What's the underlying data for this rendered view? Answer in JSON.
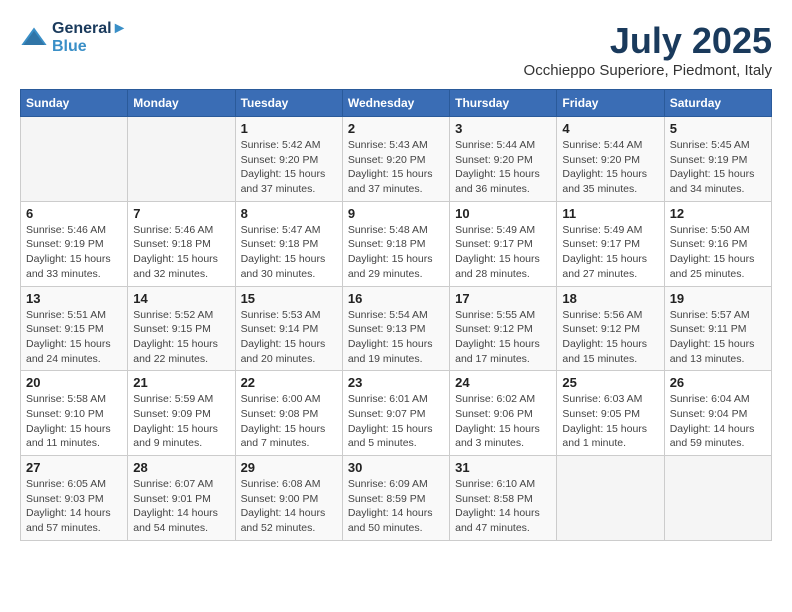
{
  "header": {
    "logo_line1": "General",
    "logo_line2": "Blue",
    "title": "July 2025",
    "subtitle": "Occhieppo Superiore, Piedmont, Italy"
  },
  "days_of_week": [
    "Sunday",
    "Monday",
    "Tuesday",
    "Wednesday",
    "Thursday",
    "Friday",
    "Saturday"
  ],
  "weeks": [
    [
      {
        "num": "",
        "empty": true
      },
      {
        "num": "",
        "empty": true
      },
      {
        "num": "1",
        "sunrise": "5:42 AM",
        "sunset": "9:20 PM",
        "daylight": "15 hours and 37 minutes."
      },
      {
        "num": "2",
        "sunrise": "5:43 AM",
        "sunset": "9:20 PM",
        "daylight": "15 hours and 37 minutes."
      },
      {
        "num": "3",
        "sunrise": "5:44 AM",
        "sunset": "9:20 PM",
        "daylight": "15 hours and 36 minutes."
      },
      {
        "num": "4",
        "sunrise": "5:44 AM",
        "sunset": "9:20 PM",
        "daylight": "15 hours and 35 minutes."
      },
      {
        "num": "5",
        "sunrise": "5:45 AM",
        "sunset": "9:19 PM",
        "daylight": "15 hours and 34 minutes."
      }
    ],
    [
      {
        "num": "6",
        "sunrise": "5:46 AM",
        "sunset": "9:19 PM",
        "daylight": "15 hours and 33 minutes."
      },
      {
        "num": "7",
        "sunrise": "5:46 AM",
        "sunset": "9:18 PM",
        "daylight": "15 hours and 32 minutes."
      },
      {
        "num": "8",
        "sunrise": "5:47 AM",
        "sunset": "9:18 PM",
        "daylight": "15 hours and 30 minutes."
      },
      {
        "num": "9",
        "sunrise": "5:48 AM",
        "sunset": "9:18 PM",
        "daylight": "15 hours and 29 minutes."
      },
      {
        "num": "10",
        "sunrise": "5:49 AM",
        "sunset": "9:17 PM",
        "daylight": "15 hours and 28 minutes."
      },
      {
        "num": "11",
        "sunrise": "5:49 AM",
        "sunset": "9:17 PM",
        "daylight": "15 hours and 27 minutes."
      },
      {
        "num": "12",
        "sunrise": "5:50 AM",
        "sunset": "9:16 PM",
        "daylight": "15 hours and 25 minutes."
      }
    ],
    [
      {
        "num": "13",
        "sunrise": "5:51 AM",
        "sunset": "9:15 PM",
        "daylight": "15 hours and 24 minutes."
      },
      {
        "num": "14",
        "sunrise": "5:52 AM",
        "sunset": "9:15 PM",
        "daylight": "15 hours and 22 minutes."
      },
      {
        "num": "15",
        "sunrise": "5:53 AM",
        "sunset": "9:14 PM",
        "daylight": "15 hours and 20 minutes."
      },
      {
        "num": "16",
        "sunrise": "5:54 AM",
        "sunset": "9:13 PM",
        "daylight": "15 hours and 19 minutes."
      },
      {
        "num": "17",
        "sunrise": "5:55 AM",
        "sunset": "9:12 PM",
        "daylight": "15 hours and 17 minutes."
      },
      {
        "num": "18",
        "sunrise": "5:56 AM",
        "sunset": "9:12 PM",
        "daylight": "15 hours and 15 minutes."
      },
      {
        "num": "19",
        "sunrise": "5:57 AM",
        "sunset": "9:11 PM",
        "daylight": "15 hours and 13 minutes."
      }
    ],
    [
      {
        "num": "20",
        "sunrise": "5:58 AM",
        "sunset": "9:10 PM",
        "daylight": "15 hours and 11 minutes."
      },
      {
        "num": "21",
        "sunrise": "5:59 AM",
        "sunset": "9:09 PM",
        "daylight": "15 hours and 9 minutes."
      },
      {
        "num": "22",
        "sunrise": "6:00 AM",
        "sunset": "9:08 PM",
        "daylight": "15 hours and 7 minutes."
      },
      {
        "num": "23",
        "sunrise": "6:01 AM",
        "sunset": "9:07 PM",
        "daylight": "15 hours and 5 minutes."
      },
      {
        "num": "24",
        "sunrise": "6:02 AM",
        "sunset": "9:06 PM",
        "daylight": "15 hours and 3 minutes."
      },
      {
        "num": "25",
        "sunrise": "6:03 AM",
        "sunset": "9:05 PM",
        "daylight": "15 hours and 1 minute."
      },
      {
        "num": "26",
        "sunrise": "6:04 AM",
        "sunset": "9:04 PM",
        "daylight": "14 hours and 59 minutes."
      }
    ],
    [
      {
        "num": "27",
        "sunrise": "6:05 AM",
        "sunset": "9:03 PM",
        "daylight": "14 hours and 57 minutes."
      },
      {
        "num": "28",
        "sunrise": "6:07 AM",
        "sunset": "9:01 PM",
        "daylight": "14 hours and 54 minutes."
      },
      {
        "num": "29",
        "sunrise": "6:08 AM",
        "sunset": "9:00 PM",
        "daylight": "14 hours and 52 minutes."
      },
      {
        "num": "30",
        "sunrise": "6:09 AM",
        "sunset": "8:59 PM",
        "daylight": "14 hours and 50 minutes."
      },
      {
        "num": "31",
        "sunrise": "6:10 AM",
        "sunset": "8:58 PM",
        "daylight": "14 hours and 47 minutes."
      },
      {
        "num": "",
        "empty": true
      },
      {
        "num": "",
        "empty": true
      }
    ]
  ],
  "labels": {
    "sunrise": "Sunrise:",
    "sunset": "Sunset:",
    "daylight": "Daylight:"
  }
}
